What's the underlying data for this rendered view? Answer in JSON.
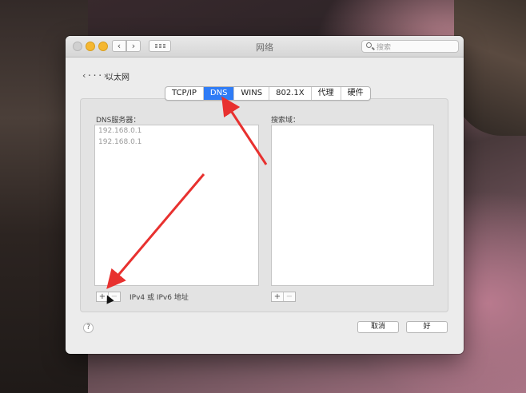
{
  "window": {
    "title": "网络",
    "search_placeholder": "搜索"
  },
  "nav": {
    "back_glyph": "‹",
    "forward_glyph": "›"
  },
  "interface": {
    "icon_text": "‹···›",
    "name": "以太网"
  },
  "tabs": [
    {
      "label": "TCP/IP",
      "active": false
    },
    {
      "label": "DNS",
      "active": true
    },
    {
      "label": "WINS",
      "active": false
    },
    {
      "label": "802.1X",
      "active": false
    },
    {
      "label": "代理",
      "active": false
    },
    {
      "label": "硬件",
      "active": false
    }
  ],
  "dns": {
    "label": "DNS服务器：",
    "servers": [
      "192.168.0.1",
      "192.168.0.1"
    ],
    "hint": "IPv4 或 IPv6 地址"
  },
  "search_domains": {
    "label": "搜索域：",
    "items": []
  },
  "buttons": {
    "add": "+",
    "remove": "−",
    "help": "?",
    "cancel": "取消",
    "ok": "好"
  },
  "colors": {
    "accent": "#2f7cf6",
    "annotation_arrow": "#e8312f"
  }
}
